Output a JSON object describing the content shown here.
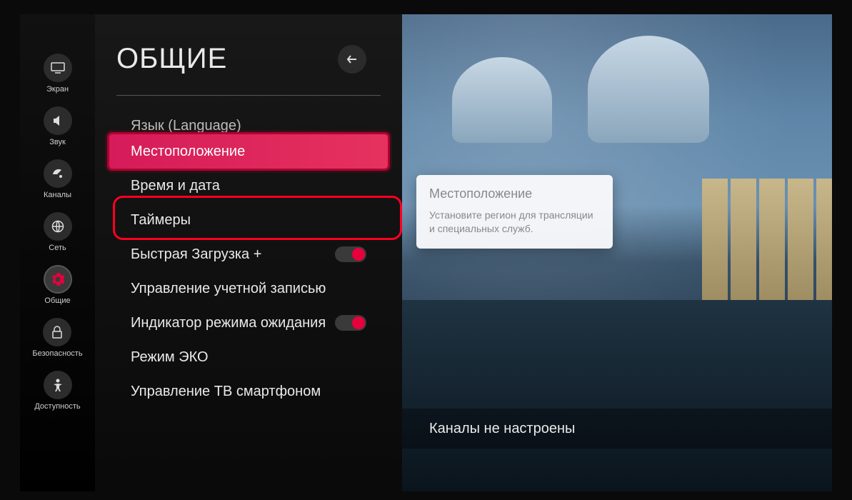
{
  "sidebar": {
    "items": [
      {
        "id": "screen",
        "label": "Экран",
        "icon": "monitor-icon"
      },
      {
        "id": "sound",
        "label": "Звук",
        "icon": "speaker-icon"
      },
      {
        "id": "channels",
        "label": "Каналы",
        "icon": "satellite-icon"
      },
      {
        "id": "network",
        "label": "Сеть",
        "icon": "globe-icon"
      },
      {
        "id": "general",
        "label": "Общие",
        "icon": "gear-icon",
        "active": true
      },
      {
        "id": "security",
        "label": "Безопасность",
        "icon": "lock-icon"
      },
      {
        "id": "accessibility",
        "label": "Доступность",
        "icon": "person-icon"
      }
    ]
  },
  "panel": {
    "title": "ОБЩИЕ",
    "items": [
      {
        "label": "Язык (Language)",
        "peek": true
      },
      {
        "label": "Местоположение",
        "selected": true
      },
      {
        "label": "Время и дата"
      },
      {
        "label": "Таймеры"
      },
      {
        "label": "Быстрая Загрузка +",
        "toggle": true
      },
      {
        "label": "Управление учетной записью"
      },
      {
        "label": "Индикатор режима ожидания",
        "toggle": true
      },
      {
        "label": "Режим ЭКО"
      },
      {
        "label": "Управление ТВ смартфоном"
      }
    ]
  },
  "tooltip": {
    "title": "Местоположение",
    "body": "Установите регион для трансляции и специальных служб."
  },
  "status": {
    "text": "Каналы не настроены"
  },
  "colors": {
    "accent": "#e6003c"
  }
}
